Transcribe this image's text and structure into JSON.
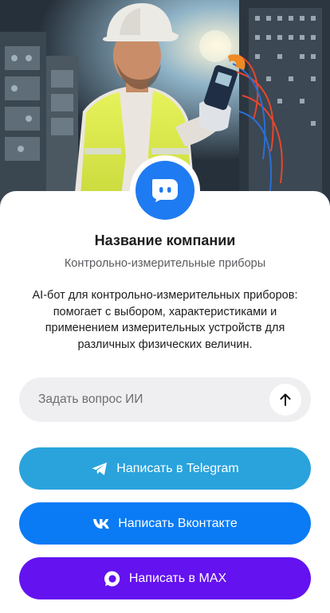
{
  "company": {
    "name": "Название компании",
    "subtitle": "Контрольно-измерительные приборы",
    "description": "AI-бот для контрольно-измерительных приборов: помогает с выбором, характеристиками и применением измерительных устройств для различных физических величин."
  },
  "ask": {
    "placeholder": "Задать вопрос ИИ",
    "value": "",
    "send_icon": "arrow-up-icon"
  },
  "buttons": {
    "telegram": {
      "label": "Написать в Telegram",
      "icon": "telegram-icon",
      "color": "#2aa3dc"
    },
    "vk": {
      "label": "Написать Вконтакте",
      "icon": "vk-icon",
      "color": "#0a7bf4"
    },
    "max": {
      "label": "Написать в MAX",
      "icon": "max-icon",
      "color": "#6412f0"
    }
  },
  "colors": {
    "accent": "#1f7bf2",
    "card_background": "#ffffff",
    "input_background": "#efeff1"
  }
}
